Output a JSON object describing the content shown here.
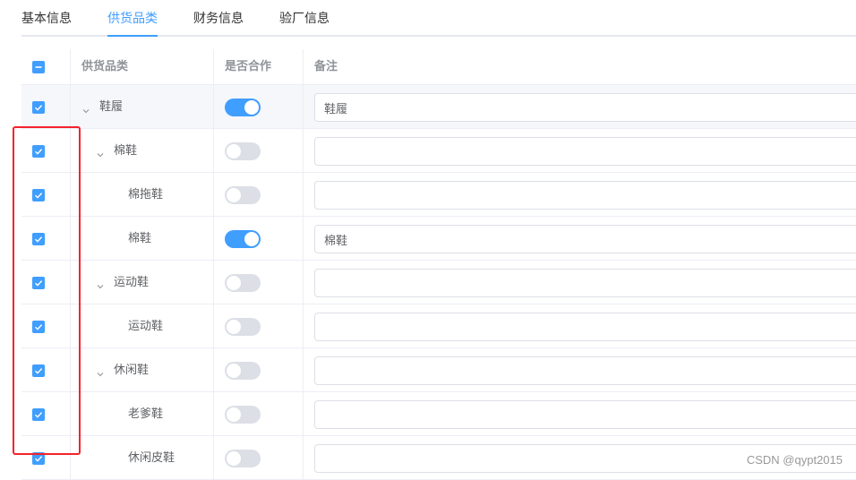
{
  "tabs": [
    {
      "label": "基本信息"
    },
    {
      "label": "供货品类"
    },
    {
      "label": "财务信息"
    },
    {
      "label": "验厂信息"
    }
  ],
  "active_tab": 1,
  "table": {
    "headers": {
      "category": "供货品类",
      "cooperate": "是否合作",
      "remark": "备注"
    },
    "rows": [
      {
        "name": "鞋履",
        "level": 0,
        "expandable": true,
        "checked": true,
        "cooperate": true,
        "remark": ""
      },
      {
        "name": "棉鞋",
        "level": 1,
        "expandable": true,
        "checked": true,
        "cooperate": false,
        "remark": ""
      },
      {
        "name": "棉拖鞋",
        "level": 2,
        "expandable": false,
        "checked": true,
        "cooperate": false,
        "remark": ""
      },
      {
        "name": "棉鞋",
        "level": 2,
        "expandable": false,
        "checked": true,
        "cooperate": true,
        "remark": "棉鞋"
      },
      {
        "name": "运动鞋",
        "level": 1,
        "expandable": true,
        "checked": true,
        "cooperate": false,
        "remark": ""
      },
      {
        "name": "运动鞋",
        "level": 2,
        "expandable": false,
        "checked": true,
        "cooperate": false,
        "remark": ""
      },
      {
        "name": "休闲鞋",
        "level": 1,
        "expandable": true,
        "checked": true,
        "cooperate": false,
        "remark": ""
      },
      {
        "name": "老爹鞋",
        "level": 2,
        "expandable": false,
        "checked": true,
        "cooperate": false,
        "remark": ""
      },
      {
        "name": "休闲皮鞋",
        "level": 2,
        "expandable": false,
        "checked": true,
        "cooperate": false,
        "remark": ""
      }
    ]
  },
  "row0_remark_value": "鞋履",
  "header_checkbox_state": "indeterminate",
  "watermark": "CSDN @qypt2015",
  "colors": {
    "accent": "#409eff",
    "highlight_box": "#f5222d",
    "toggle_off": "#dcdfe6"
  },
  "icons": {
    "expand": "chevron-down-icon",
    "checkbox": "check-icon"
  }
}
